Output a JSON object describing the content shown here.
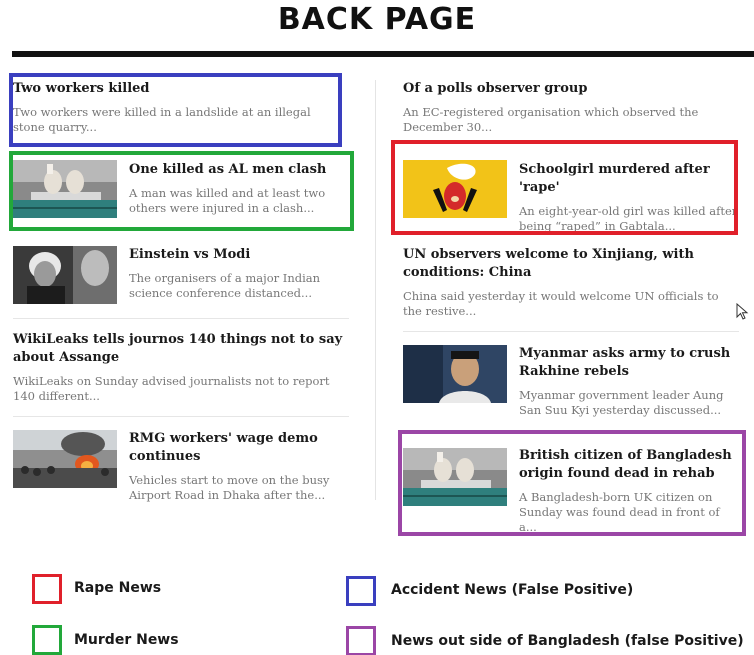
{
  "page": {
    "title": "BACK PAGE"
  },
  "colors": {
    "rape": "#e0202a",
    "accident": "#3a3fbf",
    "murder": "#22a83a",
    "outside": "#9b46a6"
  },
  "left_column": [
    {
      "headline": "Two workers killed",
      "summary": "Two workers were killed in a landslide at an illegal stone quarry...",
      "thumb": null
    },
    {
      "headline": "One killed as AL men clash",
      "summary": "A man was killed and at least two others were injured in a clash...",
      "thumb": "morgue-feet-image"
    },
    {
      "headline": "Einstein vs Modi",
      "summary": "The organisers of a major Indian science conference distanced...",
      "thumb": "einstein-photo"
    },
    {
      "headline": "WikiLeaks tells journos 140 things not to say about Assange",
      "summary": "WikiLeaks on Sunday advised journalists not to report 140 different...",
      "thumb": null
    },
    {
      "headline": "RMG workers' wage demo continues",
      "summary": "Vehicles start to move on the busy Airport Road in Dhaka after the...",
      "thumb": "protest-fire-photo"
    }
  ],
  "right_column": [
    {
      "headline": "Of a polls observer group",
      "summary": "An EC-registered organisation which observed the December 30...",
      "thumb": null
    },
    {
      "headline": "Schoolgirl murdered after 'rape'",
      "summary": "An eight-year-old girl was killed after being “raped” in Gabtala...",
      "thumb": "girl-illustration"
    },
    {
      "headline": "UN observers welcome to Xinjiang, with conditions: China",
      "summary": "China said yesterday it would welcome UN officials to the restive...",
      "thumb": null
    },
    {
      "headline": "Myanmar asks army to crush Rakhine rebels",
      "summary": "Myanmar government leader Aung San Suu Kyi yesterday discussed...",
      "thumb": "suu-kyi-photo"
    },
    {
      "headline": "British citizen of Bangladesh origin found dead in rehab",
      "summary": "A Bangladesh-born UK citizen on Sunday was found dead in front of a...",
      "thumb": "morgue-feet-image"
    }
  ],
  "legend": [
    {
      "label": "Rape News",
      "color": "#e0202a"
    },
    {
      "label": "Accident News (False Positive)",
      "color": "#3a3fbf"
    },
    {
      "label": "Murder News",
      "color": "#22a83a"
    },
    {
      "label": "News out side of Bangladesh (false Positive)",
      "color": "#9b46a6"
    }
  ]
}
